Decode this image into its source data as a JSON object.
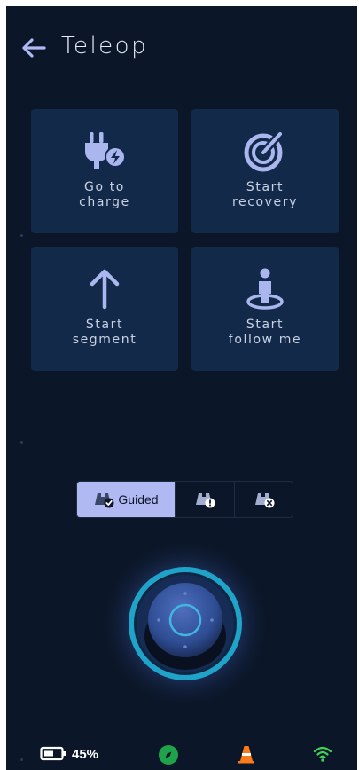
{
  "header": {
    "title": "Teleop",
    "back_icon": "arrow-left-icon"
  },
  "actions": [
    {
      "label": "Go to\ncharge",
      "icon": "plug-charge-icon"
    },
    {
      "label": "Start\nrecovery",
      "icon": "radar-icon"
    },
    {
      "label": "Start\nsegment",
      "icon": "arrow-up-icon"
    },
    {
      "label": "Start\nfollow me",
      "icon": "person-target-icon"
    }
  ],
  "modes": {
    "selected": "Guided",
    "items": [
      {
        "label": "Guided",
        "icon": "binoculars-check-icon"
      },
      {
        "label": "",
        "icon": "binoculars-warning-icon"
      },
      {
        "label": "",
        "icon": "binoculars-x-icon"
      }
    ]
  },
  "joystick": {
    "icon": "joystick-icon"
  },
  "status": {
    "battery": "45%",
    "battery_icon": "battery-icon",
    "compass_icon": "compass-icon",
    "cone_icon": "traffic-cone-icon",
    "wifi_icon": "wifi-icon"
  },
  "colors": {
    "background": "#0b1628",
    "tile": "#13294a",
    "accent": "#b0b9f2",
    "icon": "#a9b7ee",
    "ring": "#1fa3c8",
    "wifi": "#3dd35a",
    "cone": "#f97b1c",
    "compass": "#1ea34a"
  }
}
